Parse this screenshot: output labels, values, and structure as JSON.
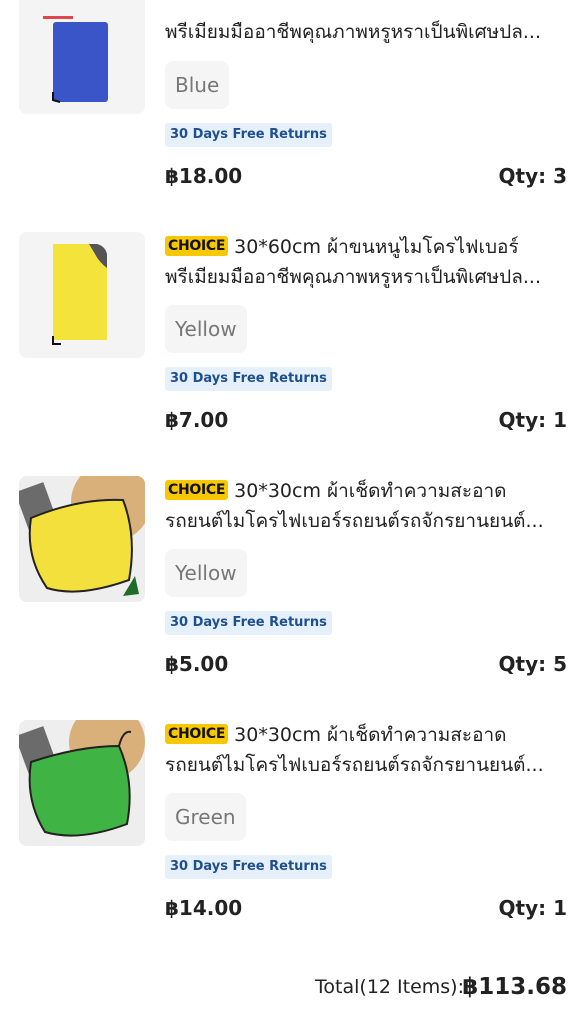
{
  "items": [
    {
      "title_line1": "",
      "title_line2": "พรีเมียมมืออาชีพคุณภาพหรูหราเป็นพิเศษปล...",
      "variant": "Blue",
      "returns": "30 Days Free Returns",
      "price": "฿18.00",
      "qty": "Qty: 3",
      "color": "#3a55c8"
    },
    {
      "choice": "CHOICE",
      "title_line1": "30*60cm ผ้าขนหนูไมโครไฟเบอร์",
      "title_line2": "พรีเมียมมืออาชีพคุณภาพหรูหราเป็นพิเศษปล...",
      "variant": "Yellow",
      "returns": "30 Days Free Returns",
      "price": "฿7.00",
      "qty": "Qty: 1",
      "color": "#f3e33a"
    },
    {
      "choice": "CHOICE",
      "title_line1": "30*30cm ผ้าเช็ดทำความสะอาด",
      "title_line2": "รถยนต์ไมโครไฟเบอร์รถยนต์รถจักรยานยนต์...",
      "variant": "Yellow",
      "returns": "30 Days Free Returns",
      "price": "฿5.00",
      "qty": "Qty: 5",
      "color": "#f4e03c"
    },
    {
      "choice": "CHOICE",
      "title_line1": "30*30cm ผ้าเช็ดทำความสะอาด",
      "title_line2": "รถยนต์ไมโครไฟเบอร์รถยนต์รถจักรยานยนต์...",
      "variant": "Green",
      "returns": "30 Days Free Returns",
      "price": "฿14.00",
      "qty": "Qty: 1",
      "color": "#3fb343"
    }
  ],
  "total": {
    "label": "Total(12 Items):",
    "value": "฿113.68"
  }
}
